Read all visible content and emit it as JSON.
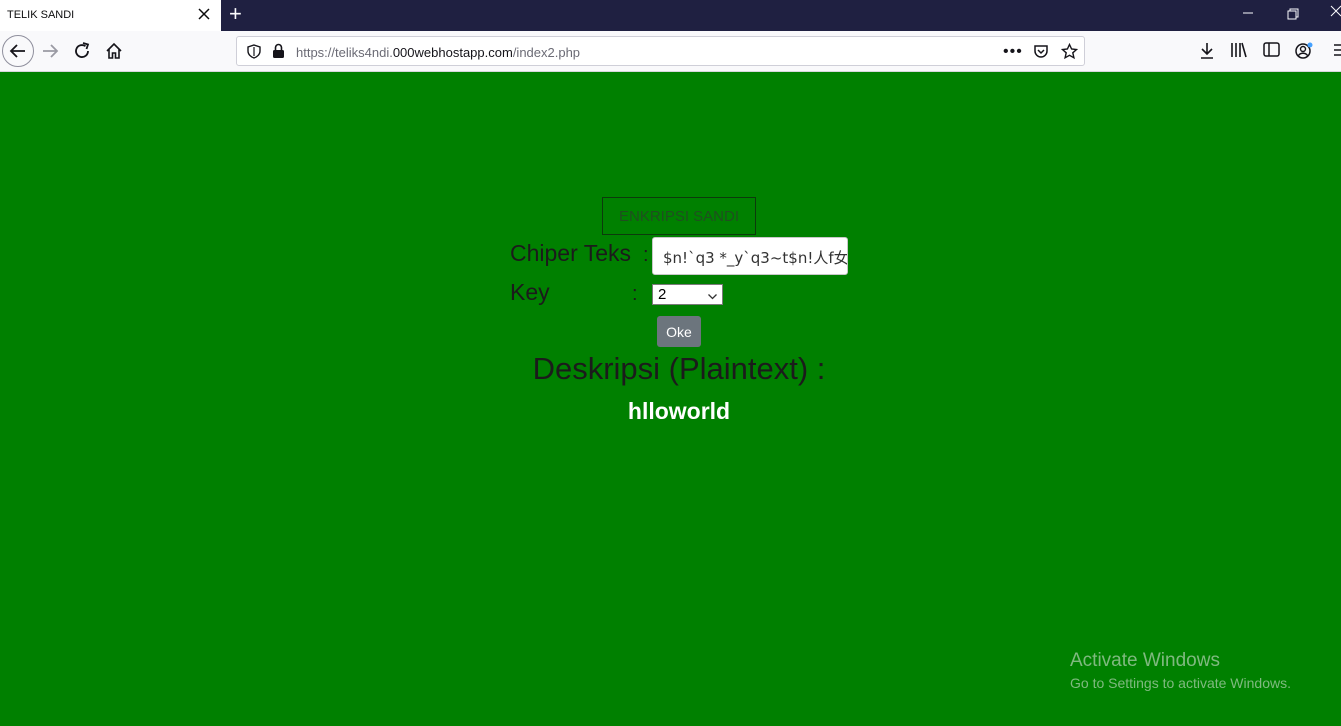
{
  "browser": {
    "tab_title": "TELIK SANDI",
    "new_tab": "+",
    "url_scheme": "https://teliks4ndi.",
    "url_host": "000webhostapp.com",
    "url_path": "/index2.php"
  },
  "page": {
    "header_button": "ENKRIPSI SANDI",
    "cipher_label": "Chiper Teks",
    "key_label": "Key",
    "colon": ":",
    "cipher_value": "$n!`q3 *_y`q3~t$n!人f女",
    "key_value": "2",
    "submit_label": "Oke",
    "result_heading": "Deskripsi (Plaintext) :",
    "result_value": "hlloworld"
  },
  "os": {
    "activate_title": "Activate Windows",
    "activate_sub": "Go to Settings to activate Windows."
  },
  "colors": {
    "page_bg": "#008000",
    "tabbar_bg": "#1f2041",
    "button_gray": "#6c757d"
  }
}
